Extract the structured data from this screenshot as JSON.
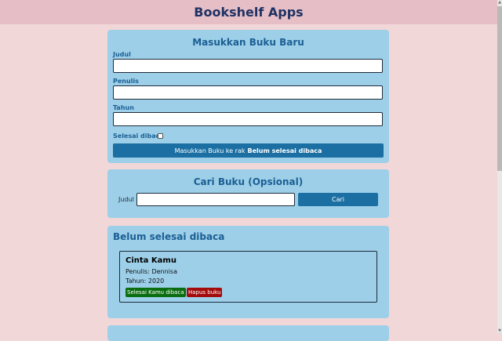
{
  "header": {
    "title": "Bookshelf Apps"
  },
  "input_form": {
    "title": "Masukkan Buku Baru",
    "title_label": "Judul",
    "title_value": "",
    "author_label": "Penulis",
    "author_value": "",
    "year_label": "Tahun",
    "year_value": "",
    "complete_label": "Selesai dibaca",
    "complete_checked": false,
    "submit_prefix": "Masukkan Buku ke rak",
    "submit_shelf": "Belum selesai dibaca"
  },
  "search": {
    "title": "Cari Buku (Opsional)",
    "label": "Judul",
    "value": "",
    "button": "Cari"
  },
  "unread_shelf": {
    "title": "Belum selesai dibaca",
    "books": [
      {
        "title": "Cinta Kamu",
        "author": "Penulis: Dennisa",
        "year": "Tahun: 2020",
        "done_button": "Selesai Kamu dibaca",
        "delete_button": "Hapus buku"
      }
    ]
  },
  "colors": {
    "background": "#f1d7d8",
    "header_bg": "#e5bec6",
    "card_bg": "#9dcfe8",
    "accent": "#1b6fa3",
    "done": "#0a6e10",
    "delete": "#a40b0b"
  }
}
